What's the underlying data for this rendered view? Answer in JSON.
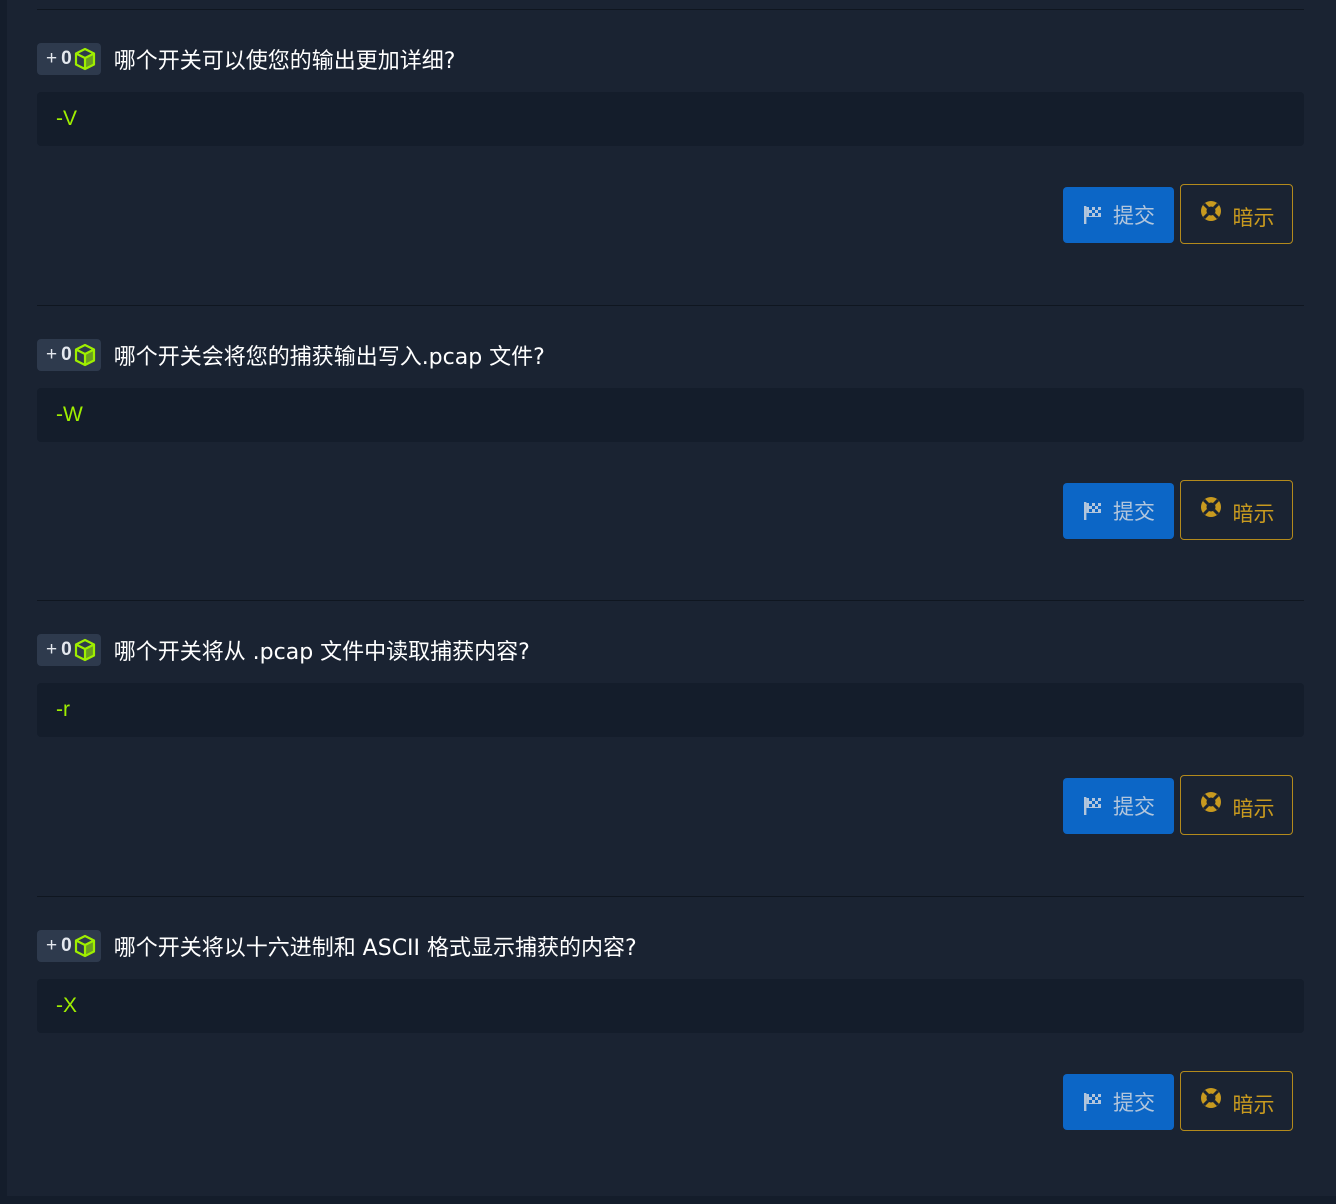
{
  "questions": [
    {
      "points": {
        "plus": "+",
        "value": "0"
      },
      "title": "哪个开关可以使您的输出更加详细?",
      "answer": "-V",
      "submit_label": "提交",
      "hint_label": "暗示"
    },
    {
      "points": {
        "plus": "+",
        "value": "0"
      },
      "title": "哪个开关会将您的捕获输出写入.pcap 文件?",
      "answer": "-W",
      "submit_label": "提交",
      "hint_label": "暗示"
    },
    {
      "points": {
        "plus": "+",
        "value": "0"
      },
      "title": "哪个开关将从 .pcap 文件中读取捕获内容?",
      "answer": "-r",
      "submit_label": "提交",
      "hint_label": "暗示"
    },
    {
      "points": {
        "plus": "+",
        "value": "0"
      },
      "title": "哪个开关将以十六进制和 ASCII 格式显示捕获的内容?",
      "answer": "-X",
      "submit_label": "提交",
      "hint_label": "暗示"
    }
  ],
  "icons": {
    "points": "cube-icon",
    "submit": "flag-icon",
    "hint": "lifebuoy-icon"
  },
  "colors": {
    "background": "#1a2332",
    "answer_background": "#141d2b",
    "answer_text": "#9fef00",
    "submit_button": "#0c66c6",
    "hint_border": "#b38a1c",
    "hint_text": "#c89a1f"
  }
}
